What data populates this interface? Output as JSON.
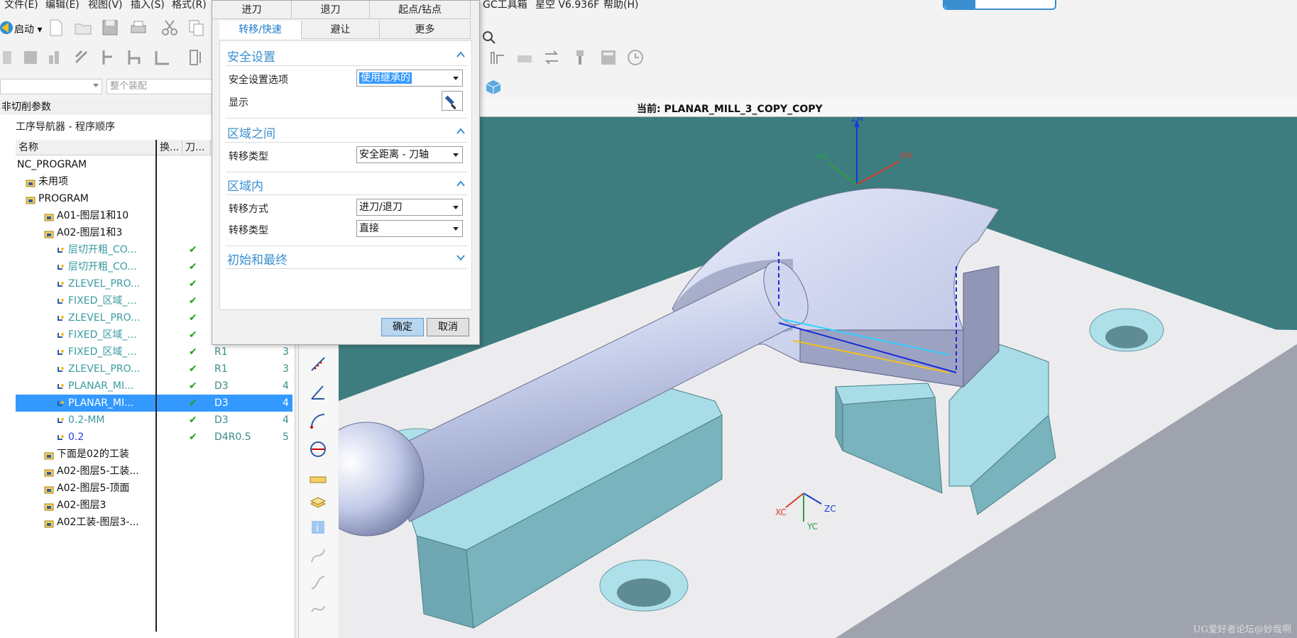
{
  "menubar": {
    "items": [
      "文件(E)",
      "编辑(E)",
      "视图(V)",
      "插入(S)",
      "格式(R)"
    ],
    "right_items": [
      "GC工具箱",
      "星空 V6.936F",
      "帮助(H)"
    ]
  },
  "toolbar": {
    "start_label": "启动",
    "assembly_placeholder": "整个装配"
  },
  "left_panel": {
    "title": "非切削参数",
    "navigator_title": "工序导航器 - 程序顺序",
    "columns": [
      "名称",
      "换...",
      "刀..."
    ],
    "rows": [
      {
        "name": "NC_PROGRAM",
        "indent": 0,
        "style": "normal",
        "chk": "",
        "tool": "",
        "num": ""
      },
      {
        "name": "未用项",
        "indent": 1,
        "style": "normal",
        "chk": "",
        "tool": "",
        "num": ""
      },
      {
        "name": "PROGRAM",
        "indent": 1,
        "style": "normal",
        "chk": "",
        "tool": "",
        "num": ""
      },
      {
        "name": "A01-图层1和10",
        "indent": 2,
        "style": "normal",
        "chk": "",
        "tool": "",
        "num": ""
      },
      {
        "name": "A02-图层1和3",
        "indent": 2,
        "style": "normal",
        "chk": "",
        "tool": "",
        "num": ""
      },
      {
        "name": "层切开粗_CO...",
        "indent": 3,
        "style": "teal",
        "chk": "✔",
        "tool": "",
        "num": ""
      },
      {
        "name": "层切开粗_CO...",
        "indent": 3,
        "style": "teal",
        "chk": "✔",
        "tool": "",
        "num": ""
      },
      {
        "name": "ZLEVEL_PRO...",
        "indent": 3,
        "style": "teal",
        "chk": "✔",
        "tool": "",
        "num": ""
      },
      {
        "name": "FIXED_区域_...",
        "indent": 3,
        "style": "teal",
        "chk": "✔",
        "tool": "",
        "num": ""
      },
      {
        "name": "ZLEVEL_PRO...",
        "indent": 3,
        "style": "teal",
        "chk": "✔",
        "tool": "",
        "num": ""
      },
      {
        "name": "FIXED_区域_...",
        "indent": 3,
        "style": "teal",
        "chk": "✔",
        "tool": "",
        "num": ""
      },
      {
        "name": "FIXED_区域_...",
        "indent": 3,
        "style": "teal",
        "chk": "✔",
        "tool": "R1",
        "num": "3"
      },
      {
        "name": "ZLEVEL_PRO...",
        "indent": 3,
        "style": "teal",
        "chk": "✔",
        "tool": "R1",
        "num": "3"
      },
      {
        "name": "PLANAR_MI...",
        "indent": 3,
        "style": "teal",
        "chk": "✔",
        "tool": "D3",
        "num": "4"
      },
      {
        "name": "PLANAR_MI...",
        "indent": 3,
        "style": "selected",
        "chk": "✔",
        "tool": "D3",
        "num": "4"
      },
      {
        "name": "0.2-MM",
        "indent": 3,
        "style": "teal",
        "chk": "✔",
        "tool": "D3",
        "num": "4"
      },
      {
        "name": "0.2",
        "indent": 3,
        "style": "blue",
        "chk": "✔",
        "tool": "D4R0.5",
        "num": "5"
      },
      {
        "name": "下面是02的工装",
        "indent": 2,
        "style": "normal",
        "chk": "",
        "tool": "",
        "num": ""
      },
      {
        "name": "A02-图层5-工装...",
        "indent": 2,
        "style": "normal",
        "chk": "",
        "tool": "",
        "num": ""
      },
      {
        "name": "A02-图层5-顶面",
        "indent": 2,
        "style": "normal",
        "chk": "",
        "tool": "",
        "num": ""
      },
      {
        "name": "A02-图层3",
        "indent": 2,
        "style": "normal",
        "chk": "",
        "tool": "",
        "num": ""
      },
      {
        "name": "A02工装-图层3-...",
        "indent": 2,
        "style": "normal",
        "chk": "",
        "tool": "",
        "num": ""
      }
    ]
  },
  "viewport": {
    "current_label": "当前: PLANAR_MILL_3_COPY_COPY",
    "axes": {
      "zm": "ZM",
      "ym": "YM",
      "xm": "XM",
      "xc": "XC",
      "yc": "YC",
      "zc": "ZC"
    },
    "bg_color": "#3d7d7f"
  },
  "dialog": {
    "tabs_row1": [
      "进刀",
      "退刀",
      "起点/钻点"
    ],
    "tabs_row2": [
      "转移/快速",
      "避让",
      "更多"
    ],
    "active_tab": "转移/快速",
    "sections": {
      "safety": {
        "title": "安全设置",
        "option_label": "安全设置选项",
        "option_value": "使用继承的",
        "display_label": "显示"
      },
      "between": {
        "title": "区域之间",
        "type_label": "转移类型",
        "type_value": "安全距离 - 刀轴"
      },
      "within": {
        "title": "区域内",
        "method_label": "转移方式",
        "method_value": "进刀/退刀",
        "type_label": "转移类型",
        "type_value": "直接"
      },
      "initial": {
        "title": "初始和最终"
      }
    },
    "ok_label": "确定",
    "cancel_label": "取消"
  },
  "watermark": "UG爱好者论坛@妙哉啊"
}
